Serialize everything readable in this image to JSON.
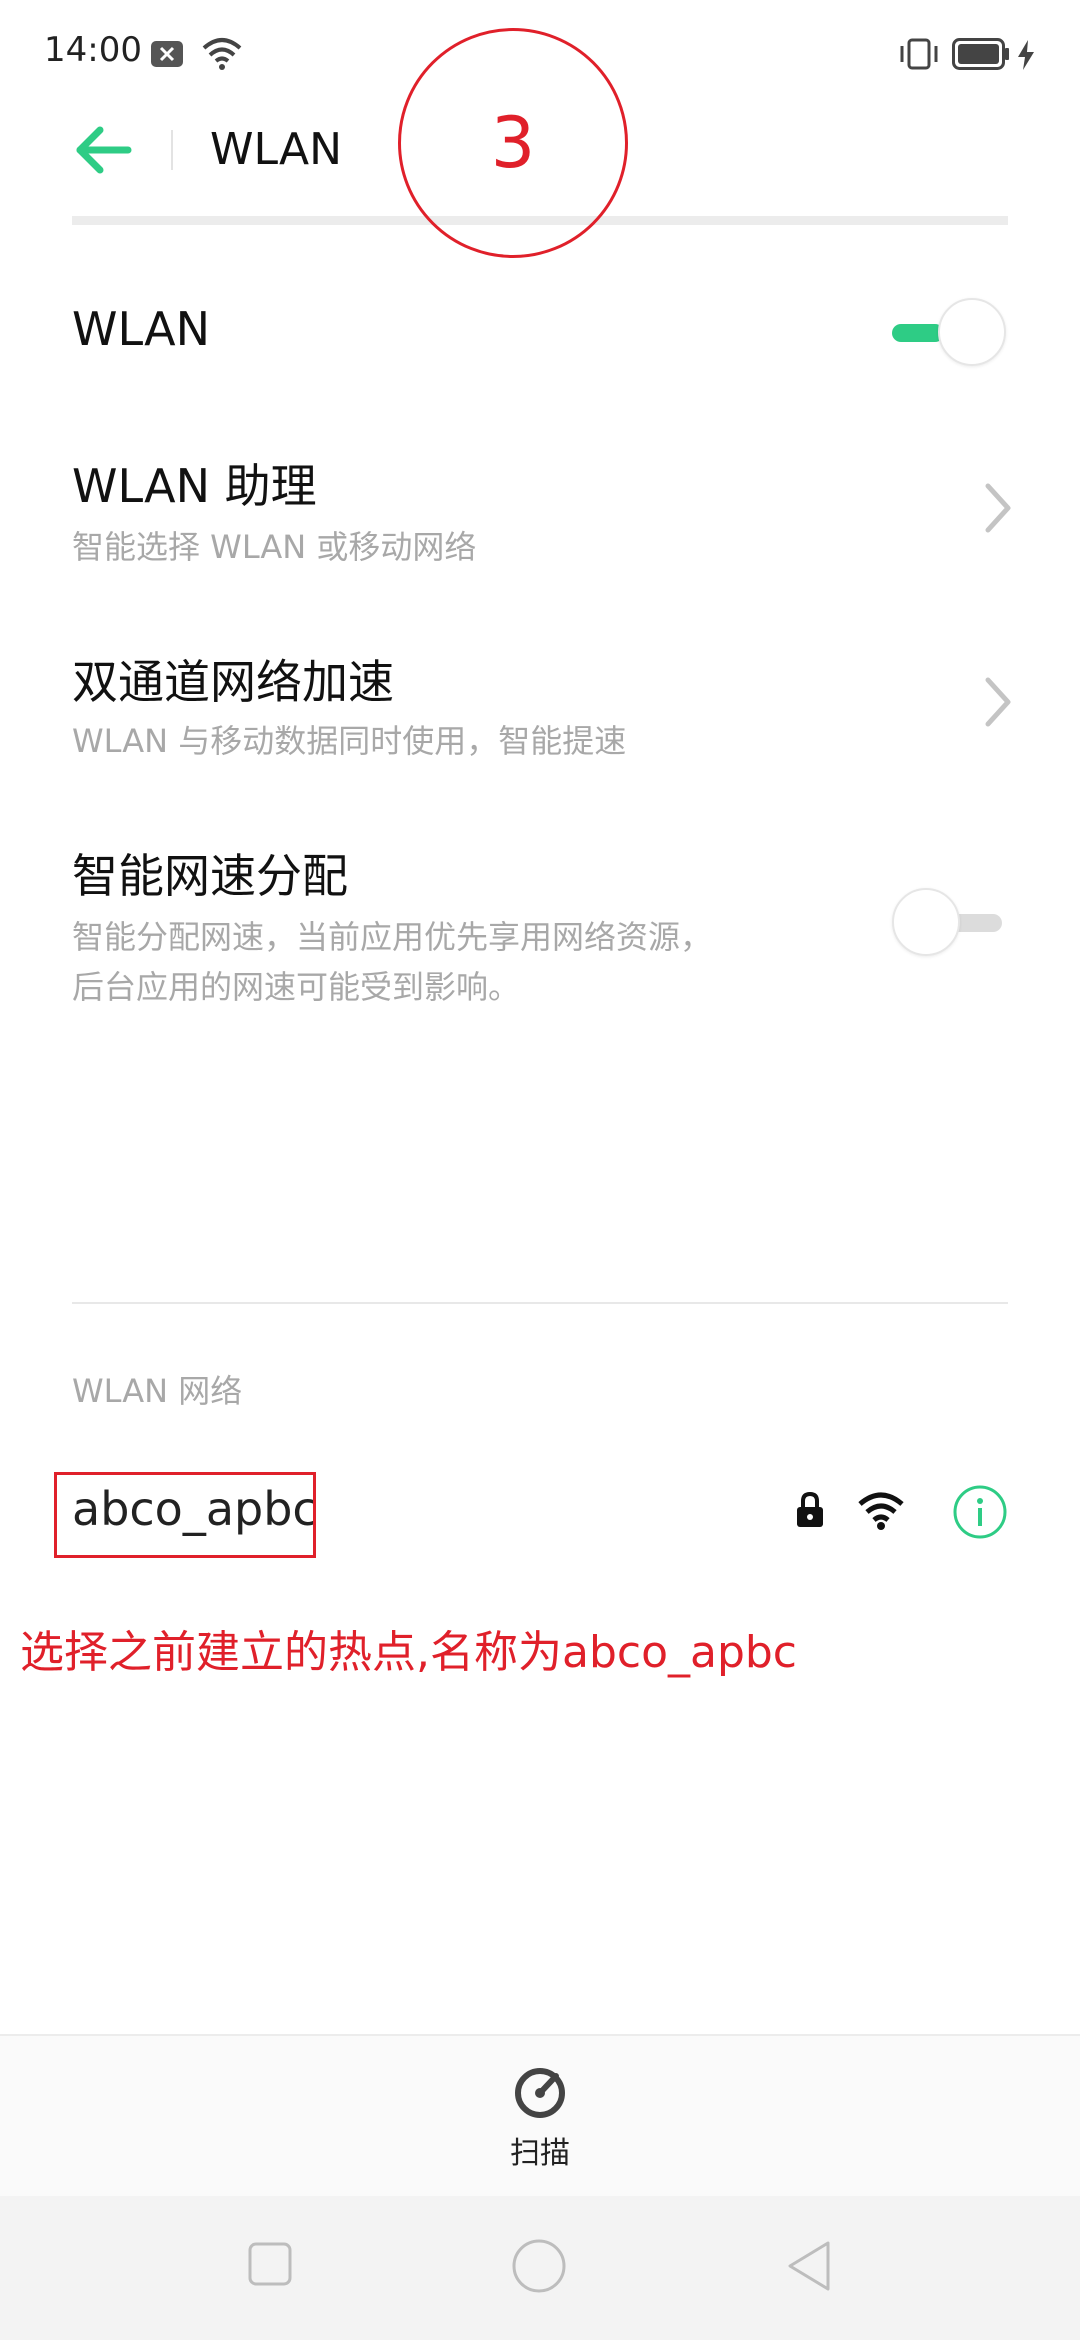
{
  "status_bar": {
    "time": "14:00",
    "icons": [
      "notification-close-icon",
      "wifi-icon",
      "vibrate-icon",
      "battery-icon",
      "charging-icon"
    ]
  },
  "header": {
    "back_icon": "back-arrow-icon",
    "title": "WLAN"
  },
  "annotation": {
    "step_number": "3",
    "instruction": "选择之前建立的热点,名称为abco_apbc"
  },
  "settings": {
    "wlan_toggle": {
      "title": "WLAN",
      "enabled": true
    },
    "wlan_assistant": {
      "title": "WLAN 助理",
      "subtitle": "智能选择 WLAN 或移动网络"
    },
    "dual_channel": {
      "title": "双通道网络加速",
      "subtitle": "WLAN 与移动数据同时使用，智能提速"
    },
    "smart_speed": {
      "title": "智能网速分配",
      "subtitle_line1": "智能分配网速，当前应用优先享用网络资源，",
      "subtitle_line2": "后台应用的网速可能受到影响。",
      "enabled": false
    }
  },
  "networks": {
    "section_label": "WLAN 网络",
    "items": [
      {
        "ssid": "abco_apbc",
        "secured": true,
        "icons": [
          "lock-icon",
          "wifi-signal-icon",
          "info-icon"
        ]
      }
    ]
  },
  "bottom": {
    "scan_label": "扫描",
    "scan_icon": "scan-icon"
  },
  "nav_bar": {
    "icons": [
      "recents-square-icon",
      "home-circle-icon",
      "back-triangle-icon"
    ]
  },
  "colors": {
    "accent": "#2ecc85",
    "annotation": "#e0202a",
    "secondary_text": "#a8a8a8"
  }
}
